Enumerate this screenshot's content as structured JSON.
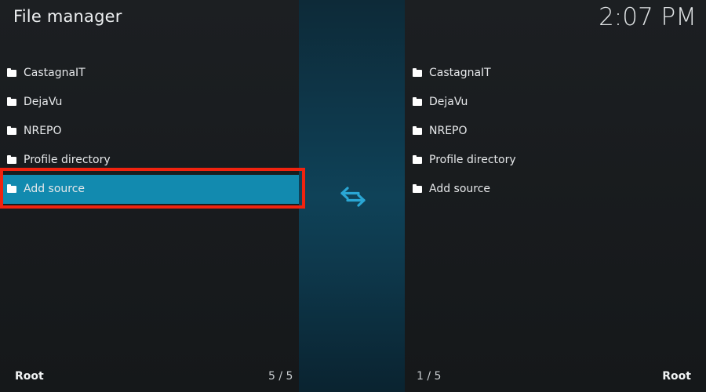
{
  "window": {
    "title": "File manager",
    "clock": "2:07 PM"
  },
  "left_pane": {
    "items": [
      {
        "label": "CastagnaIT",
        "icon": "folder-icon"
      },
      {
        "label": "DejaVu",
        "icon": "folder-icon"
      },
      {
        "label": "NREPO",
        "icon": "folder-icon"
      },
      {
        "label": "Profile directory",
        "icon": "folder-icon"
      },
      {
        "label": "Add source",
        "icon": "folder-icon",
        "focused": true
      }
    ],
    "path": "Root",
    "count": "5 / 5"
  },
  "right_pane": {
    "items": [
      {
        "label": "CastagnaIT",
        "icon": "folder-icon"
      },
      {
        "label": "DejaVu",
        "icon": "folder-icon"
      },
      {
        "label": "NREPO",
        "icon": "folder-icon"
      },
      {
        "label": "Profile directory",
        "icon": "folder-icon"
      },
      {
        "label": "Add source",
        "icon": "folder-icon"
      }
    ],
    "path": "Root",
    "count": "1 / 5"
  },
  "center": {
    "icon": "swap-arrows-icon"
  },
  "colors": {
    "focus_bg": "#128aaf",
    "highlight_border": "#f0230f",
    "swap_icon": "#2aa6d4"
  }
}
